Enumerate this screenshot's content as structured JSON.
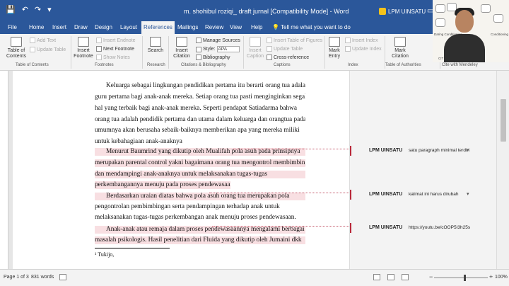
{
  "window": {
    "title": "m. shohibul roziqi_ draft jurnal [Compatibility Mode] - Word",
    "user": "LPM UINSATU",
    "qat": {
      "save_icon": "💾",
      "undo_icon": "↶",
      "redo_icon": "↷",
      "more_icon": "▾"
    },
    "minimize_icon": "▭"
  },
  "tabs": [
    "File",
    "Home",
    "Insert",
    "Draw",
    "Design",
    "Layout",
    "References",
    "Mailings",
    "Review",
    "View",
    "Help"
  ],
  "active_tab": "References",
  "tell_me": "Tell me what you want to do",
  "ribbon": {
    "toc": {
      "label_1": "Table of",
      "label_2": "Contents",
      "add_text": "Add Text",
      "update_table": "Update Table",
      "group": "Table of Contents"
    },
    "footnotes": {
      "insert_footnote_1": "Insert",
      "insert_footnote_2": "Footnote",
      "insert_endnote": "Insert Endnote",
      "next_footnote": "Next Footnote",
      "show_notes": "Show Notes",
      "group": "Footnotes"
    },
    "research": {
      "search": "Search",
      "group": "Research"
    },
    "citations": {
      "insert_citation_1": "Insert",
      "insert_citation_2": "Citation",
      "manage_sources": "Manage Sources",
      "style_label": "Style:",
      "style_value": "APA",
      "bibliography": "Bibliography",
      "group": "Citations & Bibliography"
    },
    "captions": {
      "insert_caption_1": "Insert",
      "insert_caption_2": "Caption",
      "insert_table_figures": "Insert Table of Figures",
      "update_table": "Update Table",
      "cross_reference": "Cross-reference",
      "group": "Captions"
    },
    "index": {
      "mark_entry_1": "Mark",
      "mark_entry_2": "Entry",
      "insert_index": "Insert Index",
      "update_index": "Update Index",
      "group": "Index"
    },
    "authorities": {
      "mark_citation_1": "Mark",
      "mark_citation_2": "Citation",
      "group": "Table of Authorities"
    },
    "mendeley": {
      "group": "Cite with Mendeley"
    }
  },
  "webcam": {
    "caption_1": "Daring Conditioning",
    "caption_2": "Conditioning",
    "caption_3": "CIT"
  },
  "document": {
    "lines": [
      "Keluarga sebagai lingkungan pendidikan pertama itu berarti orang tua adalah",
      "guru pertama bagi anak-anak mereka. Setiap orang tua pasti menginginkan segala",
      "hal yang terbaik bagi anak-anak mereka. Seperti pendapat Satiadarma bahwa",
      "orang tua adalah pendidik pertama dan utama dalam keluarga dan orangtua pada",
      "umumnya akan berusaha sebaik-baiknya memberikan apa yang mereka miliki",
      "untuk kebahagiaan anak-anaknya",
      "Menurut Baumrind yang dikutip oleh Mualifah pola asuh pada prinsipnya",
      "merupakan parental control yakni bagaimana orang tua mengontrol membimbing",
      "dan mendampingi anak-anaknya untuk melaksanakan tugas-tugas",
      "perkembangannya menuju pada proses pendewasaan.",
      "Berdasarkan uraian diatas bahwa pola asuh orang tua merupakan pola",
      "pengontrolan pembimbingan serta pendampingan terhadap anak untuk",
      "melaksanakan tugas-tugas perkembangan anak menuju proses pendewasaan.",
      "Anak-anak atau remaja dalam proses pendewasaannya mengalami berbagai",
      "masalah psikologis. Hasil penelitian dari Fluida yang dikutip oleh Jumaini dkk"
    ],
    "footnote": "¹ Tukijo,"
  },
  "comments": [
    {
      "author": "LPM UINSATU",
      "text": "satu paragraph minimal terdiri",
      "arrow": "▾"
    },
    {
      "author": "LPM UINSATU",
      "text": "kalimat ini harus dirubah",
      "arrow": "▾"
    },
    {
      "author": "LPM UINSATU",
      "text": "https://youtu.be/cOOP5I3h25s",
      "arrow": ""
    }
  ],
  "status": {
    "page": "Page 1 of 3",
    "words": "831 words",
    "zoom": "100%",
    "zoom_minus": "−",
    "zoom_plus": "+"
  }
}
